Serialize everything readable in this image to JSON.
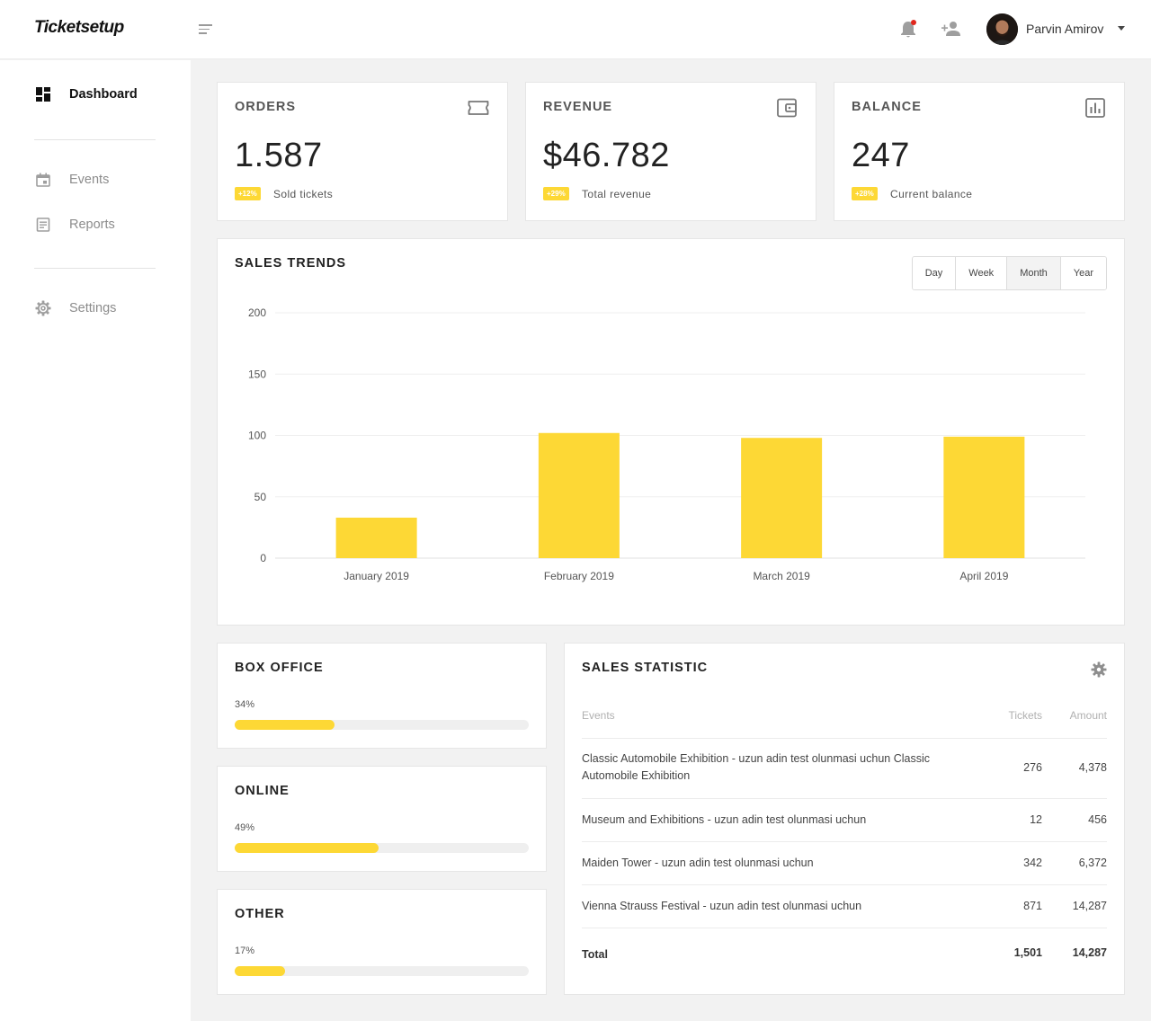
{
  "app": {
    "logo": "Ticketsetup"
  },
  "header": {
    "user_name": "Parvin Amirov"
  },
  "sidebar": {
    "items": [
      {
        "label": "Dashboard"
      },
      {
        "label": "Events"
      },
      {
        "label": "Reports"
      },
      {
        "label": "Settings"
      }
    ]
  },
  "stats": [
    {
      "title": "ORDERS",
      "value": "1.587",
      "badge": "+12%",
      "subtitle": "Sold tickets",
      "icon": "ticket-icon"
    },
    {
      "title": "REVENUE",
      "value": "$46.782",
      "badge": "+29%",
      "subtitle": "Total revenue",
      "icon": "wallet-icon"
    },
    {
      "title": "BALANCE",
      "value": "247",
      "badge": "+28%",
      "subtitle": "Current balance",
      "icon": "bar-chart-icon"
    }
  ],
  "sales_trends": {
    "title": "SALES TRENDS",
    "periods": [
      "Day",
      "Week",
      "Month",
      "Year"
    ],
    "selected_period": "Month"
  },
  "chart_data": {
    "type": "bar",
    "title": "SALES TRENDS",
    "categories": [
      "January 2019",
      "February 2019",
      "March 2019",
      "April 2019"
    ],
    "values": [
      33,
      102,
      98,
      99
    ],
    "ylim": [
      0,
      200
    ],
    "yticks": [
      0,
      50,
      100,
      150,
      200
    ],
    "grid": true,
    "color": "#fdd835"
  },
  "channels": [
    {
      "title": "BOX OFFICE",
      "percent_label": "34%",
      "fraction": 0.34
    },
    {
      "title": "ONLINE",
      "percent_label": "49%",
      "fraction": 0.49
    },
    {
      "title": "OTHER",
      "percent_label": "17%",
      "fraction": 0.17
    }
  ],
  "sales_statistic": {
    "title": "SALES STATISTIC",
    "columns": [
      "Events",
      "Tickets",
      "Amount"
    ],
    "rows": [
      {
        "event": "Classic Automobile Exhibition - uzun adin test olunmasi uchun Classic Automobile Exhibition",
        "tickets": "276",
        "amount": "4,378"
      },
      {
        "event": "Museum and Exhibitions - uzun adin test olunmasi uchun",
        "tickets": "12",
        "amount": "456"
      },
      {
        "event": "Maiden Tower - uzun adin test olunmasi uchun",
        "tickets": "342",
        "amount": "6,372"
      },
      {
        "event": "Vienna Strauss Festival - uzun adin test olunmasi uchun",
        "tickets": "871",
        "amount": "14,287"
      }
    ],
    "total": {
      "label": "Total",
      "tickets": "1,501",
      "amount": "14,287"
    }
  },
  "colors": {
    "accent": "#fdd835",
    "notification": "#e1261c"
  }
}
